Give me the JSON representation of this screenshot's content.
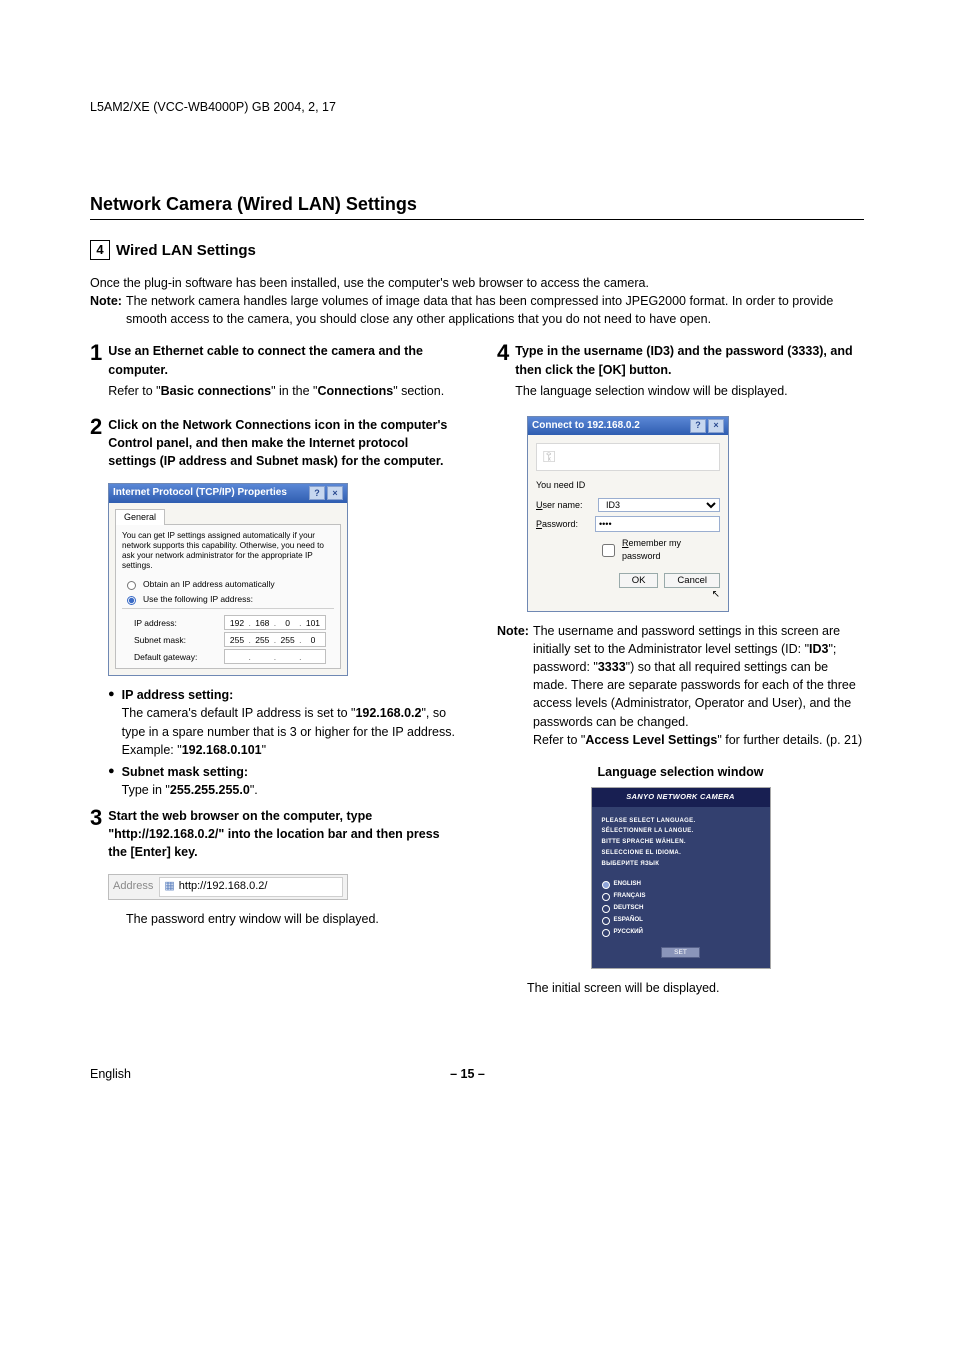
{
  "header_line": "L5AM2/XE (VCC-WB4000P)    GB    2004, 2, 17",
  "title": "Network Camera (Wired LAN) Settings",
  "section": {
    "number": "4",
    "heading": "Wired LAN Settings"
  },
  "intro": {
    "line1": "Once the plug-in software has been installed, use the computer's web browser to access the camera.",
    "note_label": "Note:",
    "note_text": "The network camera handles large volumes of image data that has been compressed into JPEG2000 format. In order to provide smooth access to the camera, you should close any other applications that you do not need to have open."
  },
  "steps": {
    "s1": {
      "num": "1",
      "title": "Use an Ethernet cable to connect the camera and the computer.",
      "desc_pre": "Refer to \"",
      "desc_bold": "Basic connections",
      "desc_mid": "\" in the \"",
      "desc_bold2": "Connections",
      "desc_post": "\" section."
    },
    "s2": {
      "num": "2",
      "title": "Click on the Network Connections icon in the computer's Control panel, and then make the Internet protocol settings (IP address and Subnet mask) for the computer."
    },
    "s3": {
      "num": "3",
      "title": "Start the web browser on the computer, type \"http://192.168.0.2/\" into the location bar and then press the [Enter] key.",
      "after": "The password entry window will be displayed."
    },
    "s4": {
      "num": "4",
      "title": "Type in the username (ID3) and the password (3333), and then click the [OK] button.",
      "desc": "The language selection window will be displayed."
    }
  },
  "tcpip_dialog": {
    "title": "Internet Protocol (TCP/IP) Properties",
    "tab": "General",
    "text": "You can get IP settings assigned automatically if your network supports this capability. Otherwise, you need to ask your network administrator for the appropriate IP settings.",
    "radio_auto": "Obtain an IP address automatically",
    "radio_manual": "Use the following IP address:",
    "ip_label": "IP address:",
    "ip_values": [
      "192",
      "168",
      "0",
      "101"
    ],
    "subnet_label": "Subnet mask:",
    "subnet_values": [
      "255",
      "255",
      "255",
      "0"
    ],
    "gateway_label": "Default gateway:"
  },
  "ip_bullets": {
    "b1_title": "IP address setting:",
    "b1_l1_pre": "The camera's default IP address is set to \"",
    "b1_l1_bold": "192.168.0.2",
    "b1_l1_post": "\", so type in a spare number that is 3 or higher for the IP address.",
    "b1_ex_pre": "Example: \"",
    "b1_ex_bold": "192.168.0.101",
    "b1_ex_post": "\"",
    "b2_title": "Subnet mask setting:",
    "b2_pre": "Type in \"",
    "b2_bold": "255.255.255.0",
    "b2_post": "\"."
  },
  "address_bar": {
    "label": "Address",
    "url": "http://192.168.0.2/"
  },
  "connect_dialog": {
    "title": "Connect to 192.168.0.2",
    "need": "You need ID",
    "user_label": "User name:",
    "user_value": "ID3",
    "pass_label": "Password:",
    "pass_value": "••••",
    "remember": "Remember my password",
    "ok": "OK",
    "cancel": "Cancel"
  },
  "note2": {
    "label": "Note:",
    "t1": "The username and password settings in this screen are initially set to the Administrator level settings (ID: \"",
    "b1": "ID3",
    "t2": "\"; password: \"",
    "b2": "3333",
    "t3": "\") so that all required settings can be made. There are separate passwords for each of the three access levels (Administrator, Operator and User), and the passwords can be changed.",
    "t4_pre": "Refer to \"",
    "t4_bold": "Access Level Settings",
    "t4_post": "\" for further details. (p. 21)"
  },
  "lang_win": {
    "caption": "Language selection window",
    "header": "SANYO NETWORK CAMERA",
    "msgs": [
      "PLEASE SELECT LANGUAGE.",
      "SÉLECTIONNER LA LANGUE.",
      "BITTE SPRACHE WÄHLEN.",
      "SELECCIONE EL IDIOMA.",
      "ВЫБEPИТE ЯЗЫК"
    ],
    "langs": [
      "ENGLISH",
      "FRANÇAIS",
      "DEUTSCH",
      "ESPAÑOL",
      "РУССКИЙ"
    ],
    "set": "SET",
    "after": "The initial screen will be displayed."
  },
  "footer": {
    "lang": "English",
    "page": "– 15 –"
  }
}
